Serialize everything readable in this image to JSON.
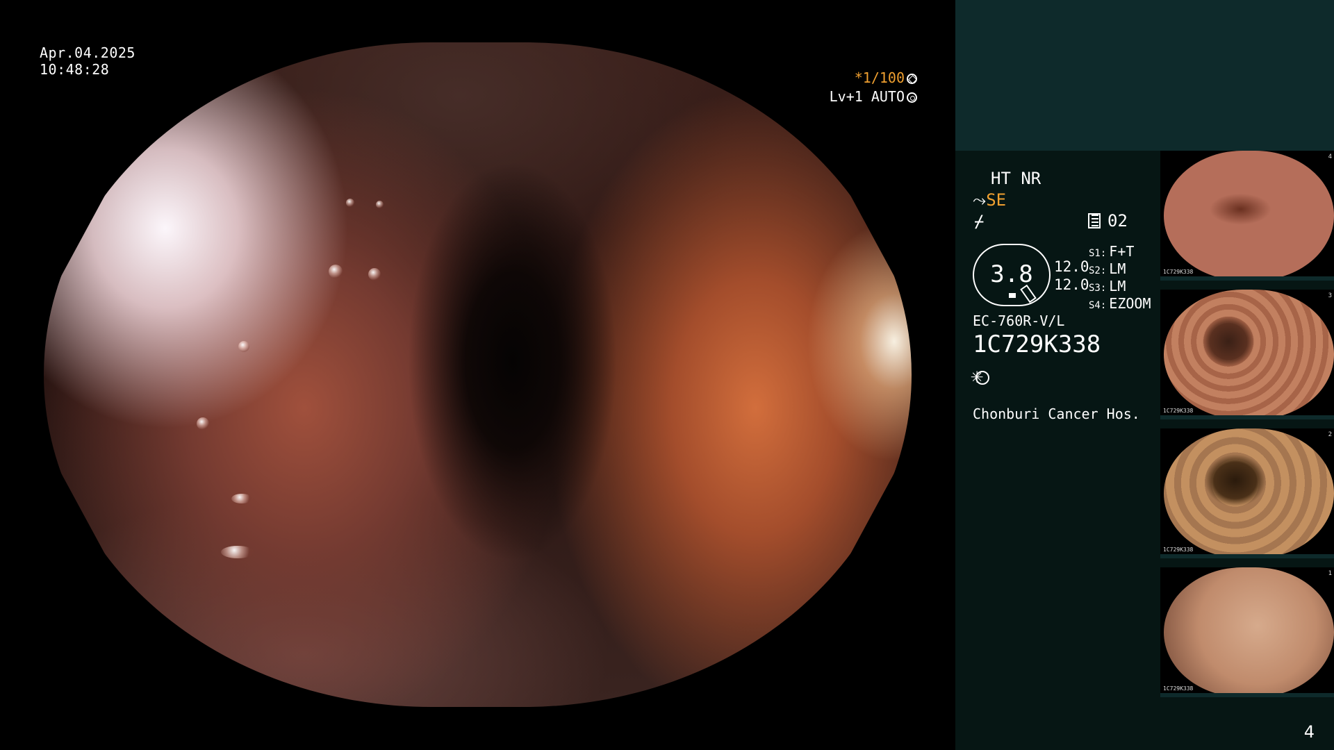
{
  "overlay": {
    "date": "Apr.04.2025",
    "time": "10:48:28",
    "shutter": "*1/100",
    "level": "Lv+1 AUTO"
  },
  "panel": {
    "ht_nr": "HT NR",
    "se": "SE",
    "mode_number": "02",
    "zoom": "3.8",
    "zoom_a": "12.0",
    "zoom_b": "12.0",
    "s1_key": "S1:",
    "s1_val": "F+T",
    "s2_key": "S2:",
    "s2_val": "LM",
    "s3_key": "S3:",
    "s3_val": "LM",
    "s4_key": "S4:",
    "s4_val": "EZOOM",
    "scope_model": "EC-760R-V/L",
    "scope_serial": "1C729K338",
    "hospital": "Chonburi Cancer Hos."
  },
  "thumbnails": [
    {
      "caption": "1C729K338",
      "index": "4"
    },
    {
      "caption": "1C729K338",
      "index": "3"
    },
    {
      "caption": "1C729K338",
      "index": "2"
    },
    {
      "caption": "1C729K338",
      "index": "1"
    }
  ],
  "page_number": "4",
  "icons": [
    "shutter-icon",
    "auto-iris-icon",
    "enhance-icon",
    "mode-icon",
    "light-icon"
  ],
  "colors": {
    "accent": "#f0a030",
    "panel_top": "#0e2a2b",
    "panel_body": "#061614"
  }
}
